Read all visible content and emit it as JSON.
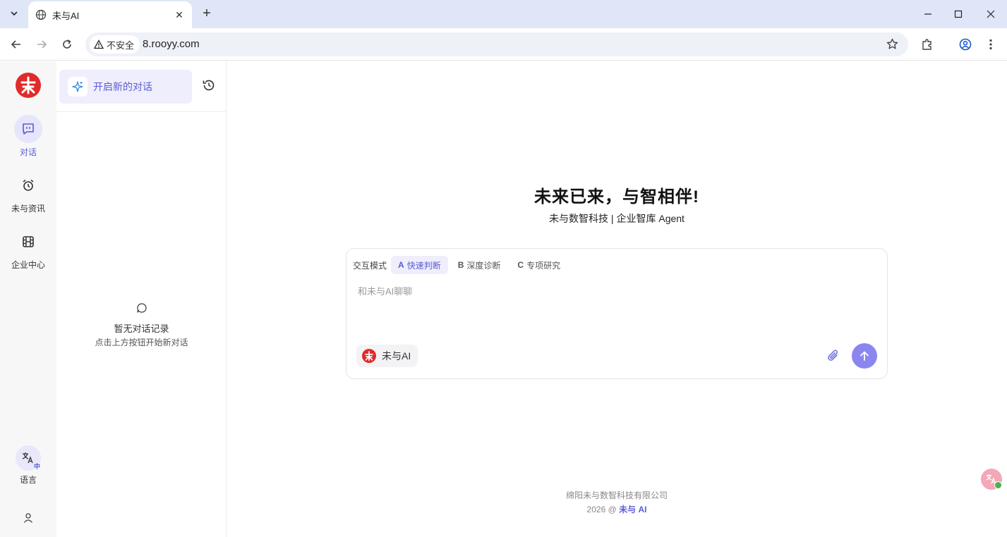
{
  "browser": {
    "tab_title": "未与AI",
    "tab_close": "✕",
    "new_tab": "+",
    "security_label": "不安全",
    "url": "8.rooyy.com"
  },
  "rail": {
    "items": [
      {
        "label": "对话",
        "icon": "chat-bubble-icon",
        "active": true
      },
      {
        "label": "未与资讯",
        "icon": "alarm-clock-icon",
        "active": false
      },
      {
        "label": "企业中心",
        "icon": "film-icon",
        "active": false
      }
    ],
    "language_label": "语言",
    "language_badge": "中"
  },
  "history": {
    "new_chat_label": "开启新的对话",
    "empty_title": "暂无对话记录",
    "empty_subtitle": "点击上方按钮开始新对话"
  },
  "main": {
    "title": "未来已来，与智相伴!",
    "subtitle": "未与数智科技 | 企业智库 Agent",
    "mode_label": "交互模式",
    "modes": [
      {
        "key": "A",
        "label": "快速判断",
        "active": true
      },
      {
        "key": "B",
        "label": "深度诊断",
        "active": false
      },
      {
        "key": "C",
        "label": "专项研究",
        "active": false
      }
    ],
    "placeholder": "和未与AI聊聊",
    "agent_name": "未与AI"
  },
  "footer": {
    "company": "绵阳未与数智科技有限公司",
    "copyright_prefix": "2026 @",
    "brand": "未与 AI"
  },
  "colors": {
    "accent": "#5b5bd6",
    "send_button": "#8b86ef",
    "logo_red": "#e02b2b"
  }
}
